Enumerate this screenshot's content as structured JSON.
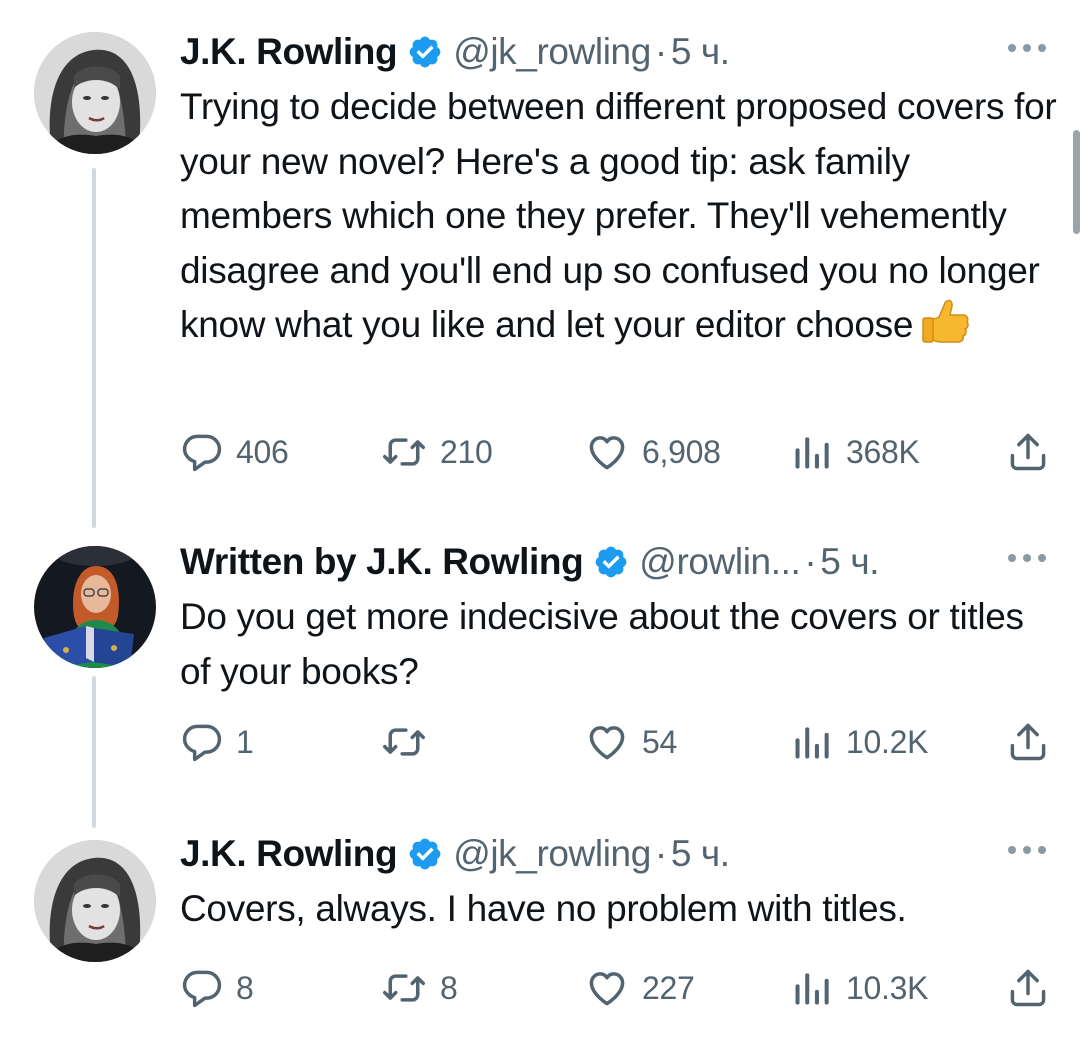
{
  "tweets": [
    {
      "display_name": "J.K. Rowling",
      "handle": "@jk_rowling",
      "separator": "·",
      "time": "5 ч.",
      "text": "Trying to decide between different proposed covers for your new novel? Here's a good tip: ask family members which one they prefer. They'll vehemently disagree and you'll end up so confused you no longer know what you like and let your editor choose",
      "emoji": "thumbs-up",
      "replies": "406",
      "reposts": "210",
      "likes": "6,908",
      "views": "368K"
    },
    {
      "display_name": "Written by J.K. Rowling",
      "handle": "@rowlin...",
      "separator": "·",
      "time": "5 ч.",
      "text": "Do you get more indecisive about the covers or titles of your books?",
      "replies": "1",
      "reposts": "",
      "likes": "54",
      "views": "10.2K"
    },
    {
      "display_name": "J.K. Rowling",
      "handle": "@jk_rowling",
      "separator": "·",
      "time": "5 ч.",
      "text": "Covers, always. I have no problem with titles.",
      "replies": "8",
      "reposts": "8",
      "likes": "227",
      "views": "10.3K"
    }
  ],
  "icons": {
    "verified": "verified-badge-icon",
    "more": "more-options-icon",
    "reply": "reply-icon",
    "repost": "repost-icon",
    "like": "like-icon",
    "views": "views-icon",
    "share": "share-icon"
  },
  "colors": {
    "verified": "#1d9bf0",
    "text": "#0f1419",
    "secondary": "#536471",
    "thread_line": "#cfd9de"
  }
}
